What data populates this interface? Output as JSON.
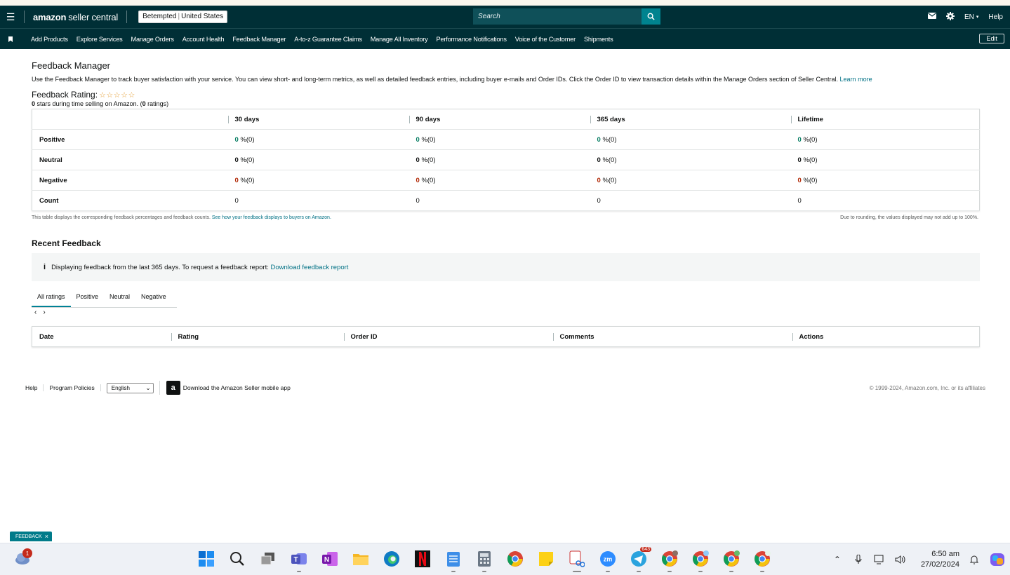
{
  "header": {
    "logo_brand": "amazon",
    "logo_product": "seller central",
    "store_name": "Betempted",
    "store_region": "United States",
    "search_placeholder": "Search",
    "language": "EN",
    "help": "Help"
  },
  "nav": {
    "items": [
      "Add Products",
      "Explore Services",
      "Manage Orders",
      "Account Health",
      "Feedback Manager",
      "A-to-z Guarantee Claims",
      "Manage All Inventory",
      "Performance Notifications",
      "Voice of the Customer",
      "Shipments"
    ],
    "edit_label": "Edit"
  },
  "page": {
    "title": "Feedback Manager",
    "description": "Use the Feedback Manager to track buyer satisfaction with your service. You can view short- and long-term metrics, as well as detailed feedback entries, including buyer e-mails and Order IDs. Click the Order ID to view transaction details within the Manage Orders section of Seller Central.",
    "learn_more": "Learn more",
    "rating_label": "Feedback Rating:",
    "stars": "☆☆☆☆☆",
    "stars_count": "0",
    "stars_text": "stars during time selling on Amazon. (",
    "ratings_count": "0",
    "ratings_text": "ratings)"
  },
  "summary_table": {
    "columns": [
      "30 days",
      "90 days",
      "365 days",
      "Lifetime"
    ],
    "rows": [
      {
        "label": "Positive",
        "values": [
          "0",
          "0",
          "0",
          "0"
        ],
        "suffix": "%(0)",
        "color": "#067d62"
      },
      {
        "label": "Neutral",
        "values": [
          "0",
          "0",
          "0",
          "0"
        ],
        "suffix": "%(0)",
        "color": "#0f1111"
      },
      {
        "label": "Negative",
        "values": [
          "0",
          "0",
          "0",
          "0"
        ],
        "suffix": "%(0)",
        "color": "#b12704"
      },
      {
        "label": "Count",
        "values": [
          "0",
          "0",
          "0",
          "0"
        ],
        "suffix": "",
        "color": "#0f1111"
      }
    ],
    "footnote_text": "This table displays the corresponding feedback percentages and feedback counts.",
    "footnote_link": "See how your feedback displays to buyers on Amazon.",
    "rounding_note": "Due to rounding, the values displayed may not add up to 100%."
  },
  "recent": {
    "title": "Recent Feedback",
    "info_text": "Displaying feedback from the last 365 days. To request a feedback report:",
    "info_link": "Download feedback report",
    "tabs": [
      "All ratings",
      "Positive",
      "Neutral",
      "Negative"
    ],
    "active_tab": 0,
    "columns": [
      "Date",
      "Rating",
      "Order ID",
      "Comments",
      "Actions"
    ]
  },
  "footer": {
    "help": "Help",
    "policies": "Program Policies",
    "language_selected": "English",
    "app_text": "Download the Amazon Seller mobile app",
    "copyright": "© 1999-2024, Amazon.com, Inc. or its affiliates"
  },
  "feedback_tab": "FEEDBACK",
  "taskbar": {
    "weather_badge": "1",
    "telegram_badge": "643",
    "time": "6:50 am",
    "date": "27/02/2024"
  },
  "colors": {
    "header_bg": "#002f36",
    "accent": "#008296",
    "positive": "#067d62",
    "negative": "#b12704"
  }
}
